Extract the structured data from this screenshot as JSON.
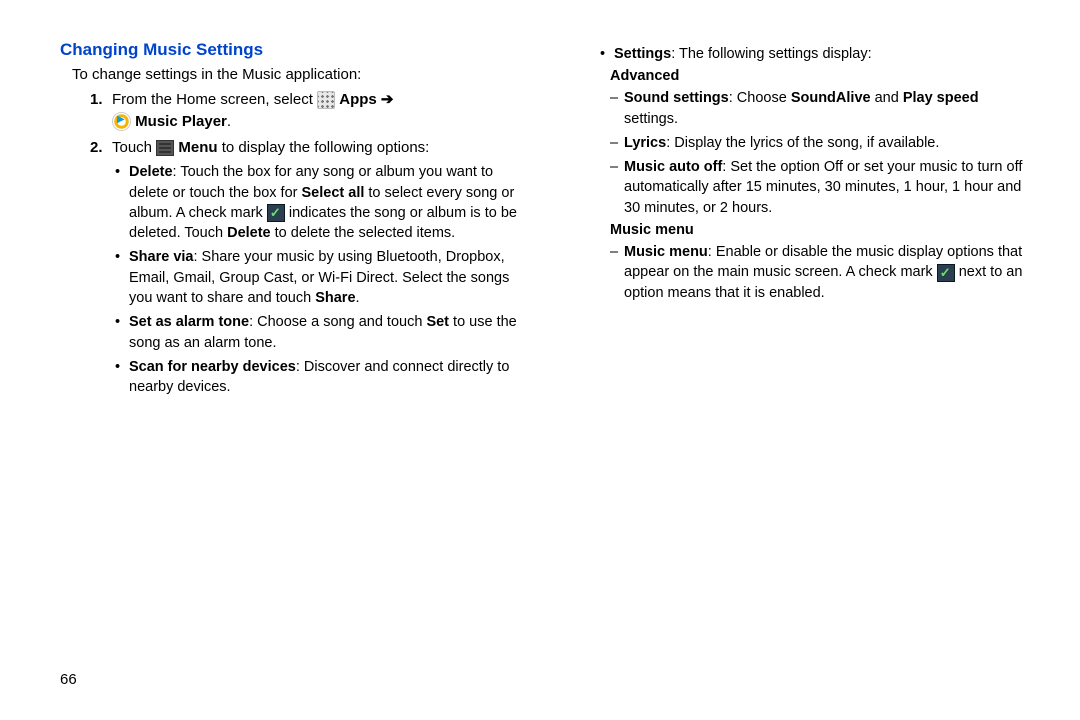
{
  "page_number": "66",
  "heading": "Changing Music Settings",
  "intro": "To change settings in the Music application:",
  "step1_num": "1.",
  "step1_a": "From the Home screen, select ",
  "step1_apps": "Apps",
  "step1_arrow": " ➔",
  "step1_music": "Music Player",
  "step1_dot": ".",
  "step2_num": "2.",
  "step2_a": "Touch ",
  "step2_menu": "Menu",
  "step2_b": " to display the following options:",
  "bul_delete_t": "Delete",
  "bul_delete_a": ": Touch the box for any song or album you want to delete or touch the box for ",
  "bul_delete_sel": "Select all",
  "bul_delete_b": " to select every song or album. A check mark ",
  "bul_delete_c": " indicates the song or album is to be deleted. Touch ",
  "bul_delete_del": "Delete",
  "bul_delete_d": " to delete the selected items.",
  "bul_share_t": "Share via",
  "bul_share_a": ": Share your music by using Bluetooth, Dropbox, Email, Gmail, Group Cast, or Wi-Fi Direct. Select the songs you want to share and touch ",
  "bul_share_s": "Share",
  "bul_share_b": ".",
  "bul_alarm_t": "Set as alarm tone",
  "bul_alarm_a": ": Choose a song and touch ",
  "bul_alarm_set": "Set",
  "bul_alarm_b": " to use the song as an alarm tone.",
  "bul_scan_t": "Scan for nearby devices",
  "bul_scan_a": ": Discover and connect directly to nearby devices.",
  "bul_settings_t": "Settings",
  "bul_settings_a": ": The following settings display:",
  "sh_advanced": "Advanced",
  "d_sound_t": "Sound settings",
  "d_sound_a": ": Choose ",
  "d_sound_sa": "SoundAlive",
  "d_sound_b": " and ",
  "d_sound_ps": "Play speed",
  "d_sound_c": " settings.",
  "d_lyrics_t": "Lyrics",
  "d_lyrics_a": ": Display the lyrics of the song, if available.",
  "d_auto_t": "Music auto off",
  "d_auto_a": ": Set the option Off or set your music to turn off automatically after 15 minutes, 30 minutes, 1 hour, 1 hour and 30 minutes, or 2 hours.",
  "sh_mm": "Music menu",
  "d_mm_t": "Music menu",
  "d_mm_a": ": Enable or disable the music display options that appear on the main music screen. A check mark ",
  "d_mm_b": " next to an option means that it is enabled."
}
